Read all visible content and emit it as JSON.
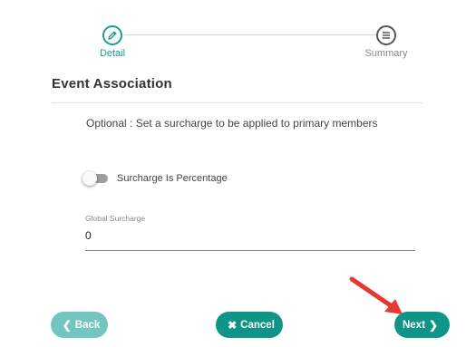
{
  "stepper": {
    "steps": [
      {
        "label": "Detail",
        "state": "active",
        "icon": "pencil-icon"
      },
      {
        "label": "Summary",
        "state": "inactive",
        "icon": "list-icon"
      }
    ]
  },
  "section": {
    "title": "Event Association",
    "description": "Optional : Set a surcharge to be applied to primary members"
  },
  "toggle": {
    "label": "Surcharge Is Percentage",
    "checked": false
  },
  "global_surcharge": {
    "label": "Global Surcharge",
    "value": "0"
  },
  "buttons": {
    "back": "Back",
    "cancel": "Cancel",
    "next": "Next"
  },
  "colors": {
    "accent": "#0f9488",
    "accent_light": "#72c5c0",
    "annotation_arrow": "#e53935"
  }
}
